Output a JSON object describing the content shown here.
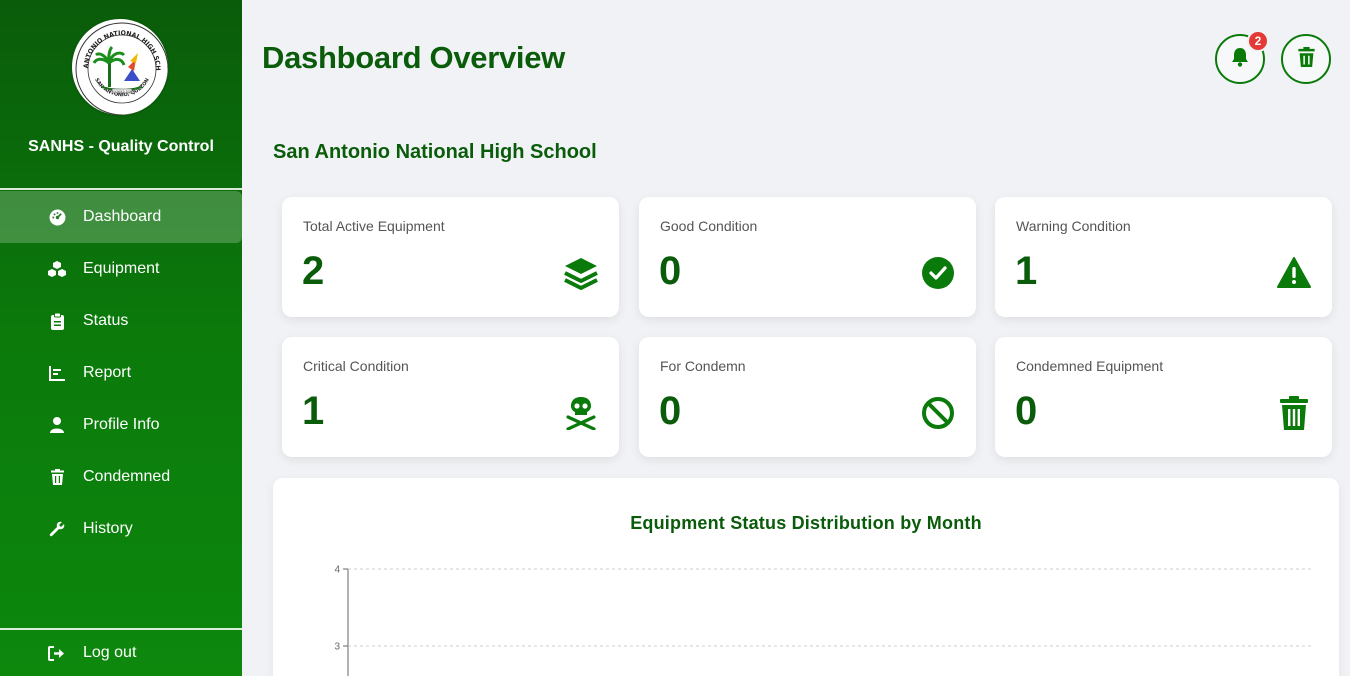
{
  "sidebar": {
    "brand": "SANHS - Quality Control",
    "logo": {
      "top_text": "SAN ANTONIO NATIONAL HIGH SCHOOL",
      "founded": "FOUNDED 2008",
      "bottom_text": "SAN ANTONIO, QUEZON"
    },
    "items": [
      {
        "label": "Dashboard",
        "icon": "gauge-icon",
        "active": true
      },
      {
        "label": "Equipment",
        "icon": "cubes-icon"
      },
      {
        "label": "Status",
        "icon": "clipboard-icon"
      },
      {
        "label": "Report",
        "icon": "chart-bar-icon"
      },
      {
        "label": "Profile Info",
        "icon": "user-icon"
      },
      {
        "label": "Condemned",
        "icon": "trash-icon"
      },
      {
        "label": "History",
        "icon": "wrench-icon"
      }
    ],
    "logout": "Log out"
  },
  "header": {
    "title": "Dashboard Overview",
    "notification_count": "2"
  },
  "school_name": "San Antonio National High School",
  "cards": [
    {
      "label": "Total Active Equipment",
      "value": "2",
      "icon": "layers-icon"
    },
    {
      "label": "Good Condition",
      "value": "0",
      "icon": "check-circle-icon"
    },
    {
      "label": "Warning Condition",
      "value": "1",
      "icon": "warning-icon"
    },
    {
      "label": "Critical Condition",
      "value": "1",
      "icon": "skull-crossbones-icon"
    },
    {
      "label": "For Condemn",
      "value": "0",
      "icon": "ban-icon"
    },
    {
      "label": "Condemned Equipment",
      "value": "0",
      "icon": "trash-icon"
    }
  ],
  "colors": {
    "primary": "#0a5c0a",
    "accent": "#0b7a0b",
    "badge": "#e53935"
  },
  "chart_data": {
    "type": "bar",
    "title": "Equipment Status Distribution by Month",
    "y_ticks": [
      "4",
      "3"
    ],
    "ylim_visible": [
      3,
      4
    ],
    "grid": true
  }
}
